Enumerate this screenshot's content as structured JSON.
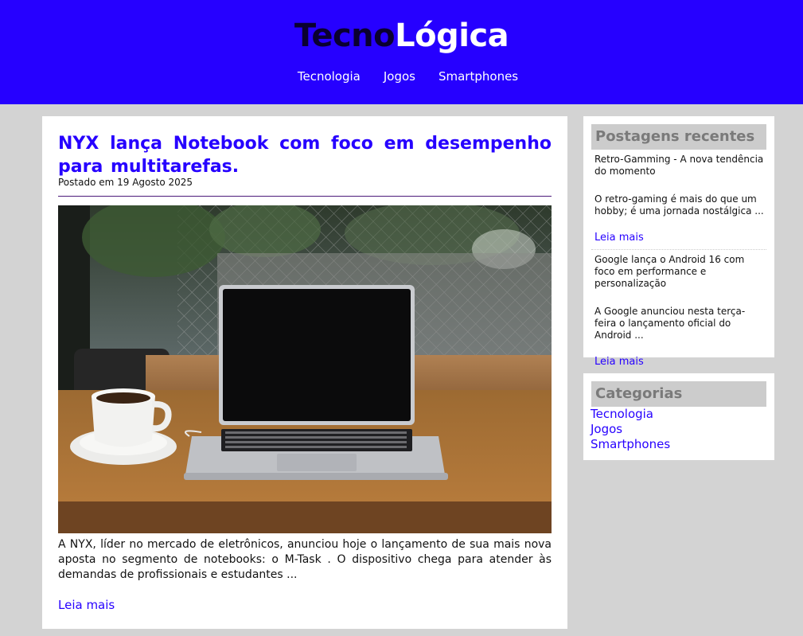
{
  "site": {
    "logo_part1": "Tecno",
    "logo_part2": "Lógica",
    "nav": [
      "Tecnologia",
      "Jogos",
      "Smartphones"
    ]
  },
  "article": {
    "title": "NYX lança Notebook com foco em desempenho para multitarefas.",
    "date": "Postado em 19 Agosto 2025",
    "excerpt": "A NYX, líder no mercado de eletrônicos, anunciou hoje o lançamento de sua mais nova aposta no segmento de notebooks: o M-Task . O dispositivo chega para atender às demandas de profissionais e estudantes ...",
    "read_more": "Leia mais"
  },
  "recent": {
    "title": "Postagens recentes",
    "items": [
      {
        "title": "Retro-Gamming - A nova tendência do momento",
        "excerpt": "O retro-gaming é mais do que um hobby; é uma jornada nostálgica ...",
        "link": "Leia mais"
      },
      {
        "title": "Google lança o Android 16 com foco em performance e personalização",
        "excerpt": "A Google anunciou nesta terça-feira o lançamento oficial do Android ...",
        "link": "Leia mais"
      }
    ]
  },
  "categories": {
    "title": "Categorias",
    "items": [
      "Tecnologia",
      "Jogos",
      "Smartphones"
    ]
  },
  "colors": {
    "header_bg": "#2600ff",
    "accent": "#2600ff",
    "page_bg": "#d3d3d3",
    "widget_title_bg": "#cccccc"
  }
}
